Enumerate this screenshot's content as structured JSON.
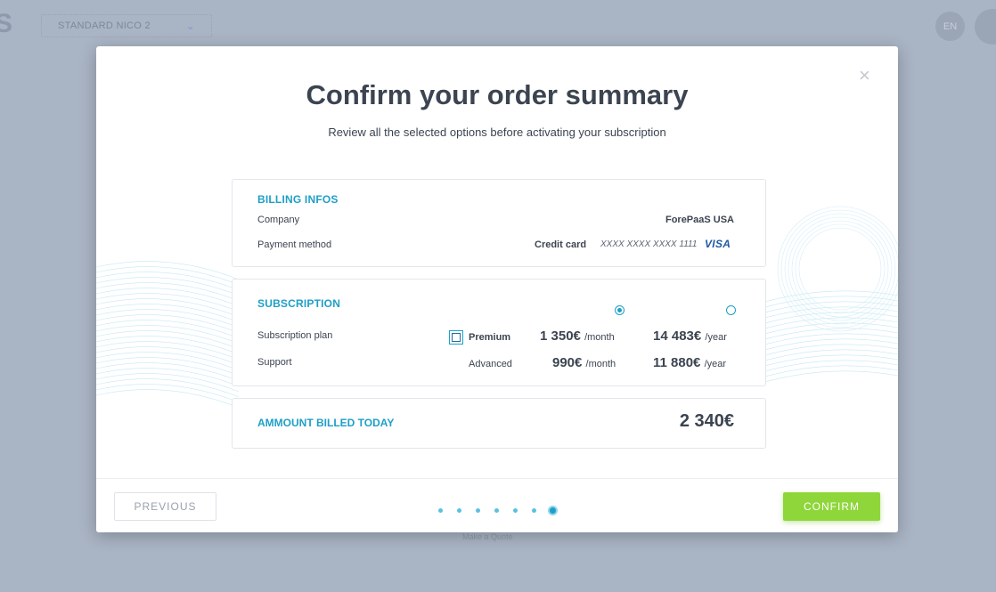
{
  "background": {
    "logo": "S",
    "project_name": "STANDARD NICO 2",
    "language": "EN",
    "footer_text": "Make a Quote"
  },
  "modal": {
    "title": "Confirm your order summary",
    "subtitle": "Review all the selected options before activating your subscription",
    "close_icon": "×"
  },
  "billing": {
    "title": "BILLING INFOS",
    "company_label": "Company",
    "company_value": "ForePaaS USA",
    "payment_label": "Payment method",
    "payment_type": "Credit card",
    "card_number": "XXXX XXXX XXXX 1111",
    "card_brand": "VISA"
  },
  "subscription": {
    "title": "SUBSCRIPTION",
    "selected_period": "monthly",
    "plan_label": "Subscription plan",
    "plan_name": "Premium",
    "plan_monthly": "1 350€",
    "plan_yearly": "14 483€",
    "support_label": "Support",
    "support_name": "Advanced",
    "support_monthly": "990€",
    "support_yearly": "11 880€",
    "unit_month": "/month",
    "unit_year": "/year"
  },
  "total": {
    "label": "AMMOUNT BILLED TODAY",
    "value": "2 340€"
  },
  "footer": {
    "previous_label": "PREVIOUS",
    "confirm_label": "CONFIRM",
    "steps_total": 7,
    "current_step": 7
  },
  "colors": {
    "accent": "#1e9fc7",
    "confirm": "#8ed63a",
    "overlay": "#a9b4c4"
  }
}
